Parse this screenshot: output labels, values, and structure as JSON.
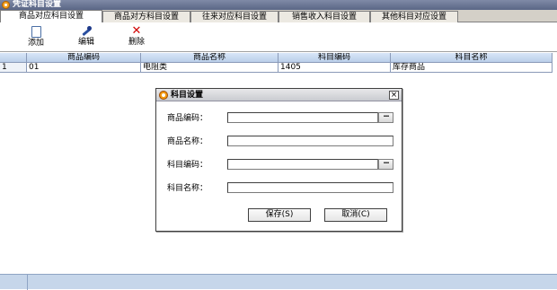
{
  "window": {
    "title": "凭证科目设置"
  },
  "tabs": [
    {
      "label": "商品对应科目设置",
      "active": true
    },
    {
      "label": "商品对方科目设置",
      "active": false
    },
    {
      "label": "往来对应科目设置",
      "active": false
    },
    {
      "label": "销售收入科目设置",
      "active": false
    },
    {
      "label": "其他科目对应设置",
      "active": false
    }
  ],
  "toolbar": {
    "add_label": "添加",
    "edit_label": "编辑",
    "delete_label": "删除"
  },
  "grid": {
    "columns": [
      "",
      "商品编码",
      "商品名称",
      "科目编码",
      "科目名称"
    ],
    "rows": [
      [
        "1",
        "01",
        "电阻类",
        "1405",
        "库存商品"
      ]
    ]
  },
  "dialog": {
    "title": "科目设置",
    "close": "×",
    "product_code_label": "商品编码：",
    "product_name_label": "商品名称：",
    "account_code_label": "科目编码：",
    "account_name_label": "科目名称：",
    "product_code_value": "",
    "product_name_value": "",
    "account_code_value": "",
    "account_name_value": "",
    "lookup_symbol": "···",
    "save_label": "保存(S)",
    "cancel_label": "取消(C)"
  },
  "colors": {
    "header_bg": "#c8daf2",
    "status_bar": "#c6d6ea",
    "delete_icon": "#d00000"
  },
  "icons": {
    "add": "new-document-icon",
    "edit": "edit-pen-icon",
    "delete": "delete-x-icon"
  }
}
